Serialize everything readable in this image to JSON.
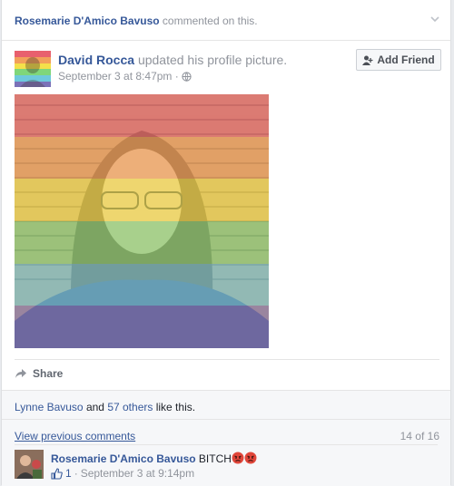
{
  "story": {
    "actor": "Rosemarie D'Amico Bavuso",
    "action": "commented on this."
  },
  "post": {
    "author": "David Rocca",
    "action": "updated his profile picture.",
    "timestamp": "September 3 at 8:47pm",
    "meta_separator": "·",
    "add_friend_label": "Add Friend",
    "share_label": "Share"
  },
  "likes": {
    "first_name": "Lynne Bavuso",
    "and_text": "and",
    "others_link": "57 others",
    "suffix": "like this."
  },
  "comments": {
    "view_previous_label": "View previous comments",
    "count_label": "14 of 16",
    "items": [
      {
        "author": "Rosemarie D'Amico Bavuso",
        "text": "BITCH",
        "like_count": "1",
        "separator": "·",
        "timestamp": "September 3 at 9:14pm"
      }
    ]
  },
  "colors": {
    "link": "#365899",
    "muted": "#90949c",
    "rainbow": [
      "#e8606e",
      "#f2a05a",
      "#f4e04a",
      "#7fd67a",
      "#6ec9dc",
      "#7b72b8"
    ]
  }
}
